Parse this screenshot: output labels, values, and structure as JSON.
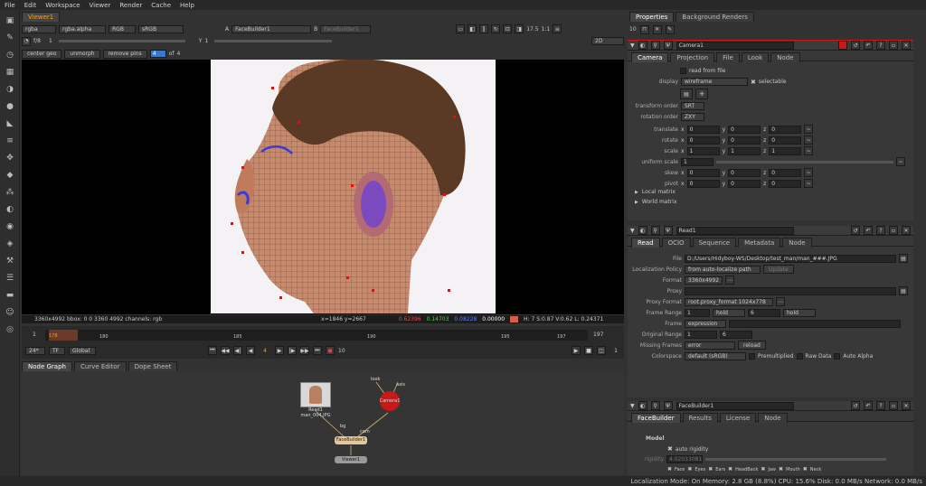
{
  "menu": [
    "File",
    "Edit",
    "Workspace",
    "Viewer",
    "Render",
    "Cache",
    "Help"
  ],
  "viewer": {
    "tab": "Viewer1",
    "channels": "rgba",
    "alpha": "rgba.alpha",
    "colorspace_sel": "RGB",
    "lut": "sRGB",
    "input_a": "FaceBuilder1",
    "input_b": "FaceBuilder1",
    "fstop": "f/8",
    "frame_field": "1",
    "y_label": "Y",
    "y_value": "1",
    "zoom": "17.5",
    "ratio": "1:1",
    "mode": "2D",
    "buttons": {
      "center": "center geo",
      "unmorph": "unmorph",
      "remove": "remove pins"
    },
    "pin_index": "4",
    "pin_of": "of",
    "pin_total": "4",
    "status_left": "3360x4992  bbox: 0 0 3360 4992 channels: rgb",
    "status_xy": "x=1846 y=2667",
    "status_r": "0.62396",
    "status_g": "0.14703",
    "status_b": "0.08228",
    "status_a": "0.00000",
    "status_hsv": "H: 7 S:0.87 V:0.62  L: 0.24371",
    "swatch": "#d2604a"
  },
  "timeline": {
    "start": "1",
    "end": "197",
    "current": "178",
    "ticks": [
      "180",
      "185",
      "190",
      "195",
      "197"
    ],
    "fps": "24*",
    "tf": "TF",
    "global": "Global",
    "frame_box": "4",
    "step": "10",
    "end_box": "1"
  },
  "bottom_tabs": [
    "Node Graph",
    "Curve Editor",
    "Dope Sheet"
  ],
  "nodes": {
    "read_label": "Read1",
    "read_file": "man_004.JPG",
    "camera_label": "Camera1",
    "facebuilder_label": "FaceBuilder1",
    "viewer_label": "Viewer1",
    "edge_bg": "bg",
    "edge_cam": "cam",
    "edge_look": "look",
    "edge_axis": "axis"
  },
  "properties": {
    "tabs": [
      "Properties",
      "Background Renders"
    ],
    "max_panels": "10",
    "camera": {
      "name": "Camera1",
      "tabs": [
        "Camera",
        "Projection",
        "File",
        "Look",
        "Node"
      ],
      "read_from_file": "read from file",
      "display_label": "display",
      "display_value": "wireframe",
      "selectable": "selectable",
      "transform_order_label": "transform order",
      "transform_order": "SRT",
      "rotation_order_label": "rotation order",
      "rotation_order": "ZXY",
      "rows": [
        {
          "label": "translate",
          "x": "0",
          "y": "0",
          "z": "0"
        },
        {
          "label": "rotate",
          "x": "0",
          "y": "0",
          "z": "0"
        },
        {
          "label": "scale",
          "x": "1",
          "y": "1",
          "z": "1"
        }
      ],
      "uniform_label": "uniform scale",
      "uniform_value": "1",
      "rows2": [
        {
          "label": "skew",
          "x": "0",
          "y": "0",
          "z": "0"
        },
        {
          "label": "pivot",
          "x": "0",
          "y": "0",
          "z": "0"
        }
      ],
      "local_matrix": "Local matrix",
      "world_matrix": "World matrix"
    },
    "read": {
      "name": "Read1",
      "tabs": [
        "Read",
        "OCIO",
        "Sequence",
        "Metadata",
        "Node"
      ],
      "file_label": "File",
      "file": "D:/Users/Hidyboy-WS/Desktop/test_man/man_###.JPG",
      "loc_label": "Localization Policy",
      "loc_value": "from auto-localize path",
      "update": "Update",
      "format_label": "Format",
      "format": "3360x4992",
      "proxy_label": "Proxy",
      "proxy_format_label": "Proxy Format",
      "proxy_format": "root.proxy_format 1024x778",
      "frame_range_label": "Frame Range",
      "fr_start": "1",
      "fr_start_mode": "hold",
      "fr_end": "6",
      "fr_end_mode": "hold",
      "frame_label": "Frame",
      "frame_value": "expression",
      "orig_range_label": "Original Range",
      "orig_start": "1",
      "orig_end": "6",
      "missing_label": "Missing Frames",
      "missing_value": "error",
      "reload": "reload",
      "colorspace_label": "Colorspace",
      "colorspace_value": "default (sRGB)",
      "premultiplied": "Premultiplied",
      "raw_data": "Raw Data",
      "auto_alpha": "Auto Alpha"
    },
    "facebuilder": {
      "name": "FaceBuilder1",
      "tabs": [
        "FaceBuilder",
        "Results",
        "License",
        "Node"
      ],
      "model": "Model",
      "auto_rigidity": "auto rigidity",
      "rigidity_label": "rigidity",
      "rigidity_value": "4.02033081",
      "checks": [
        "Face",
        "Eyes",
        "Ears",
        "HeadBack",
        "Jaw",
        "Mouth",
        "Neck"
      ]
    }
  },
  "statusbar": {
    "text": "Localization Mode: On Memory: 2.8 GB (8.8%) CPU: 15.6% Disk: 0.0 MB/s Network: 0.0 MB/s"
  },
  "colors": {
    "accent": "#3a78c8",
    "panel": "#323232",
    "dark": "#1c1c1c",
    "camera_node": "#c81818",
    "fb_node": "#e6c79a"
  }
}
